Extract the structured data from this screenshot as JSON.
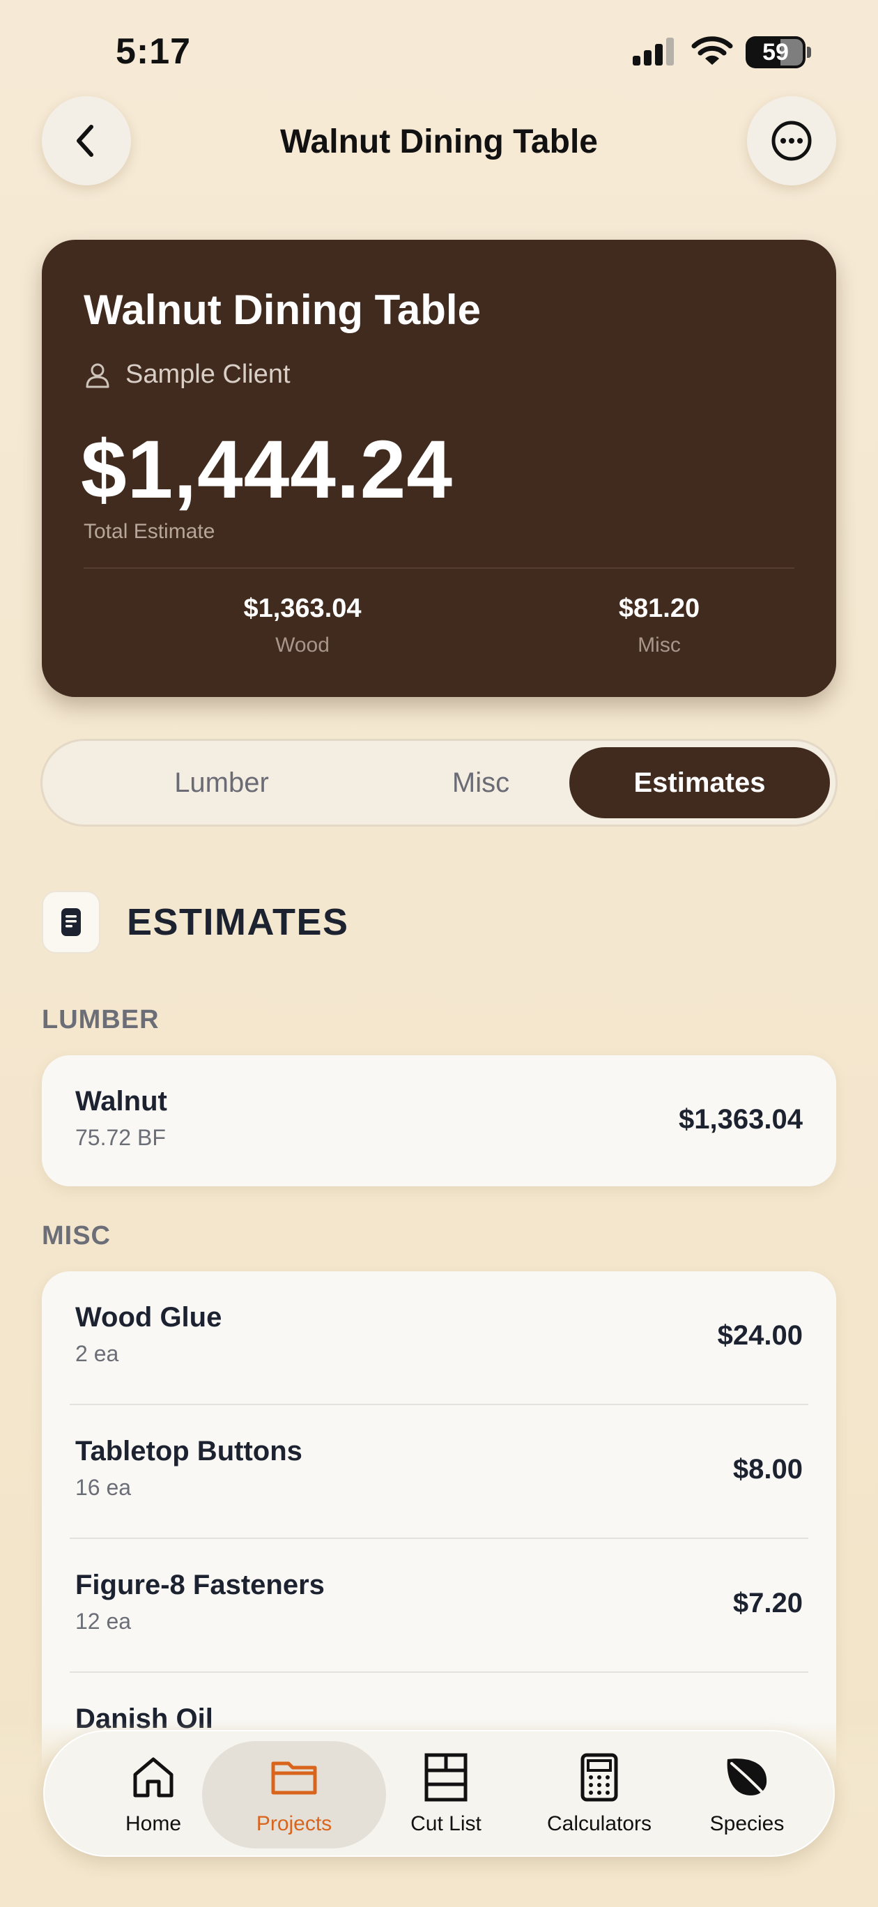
{
  "status_bar": {
    "time": "5:17",
    "battery": "59"
  },
  "nav": {
    "title": "Walnut Dining Table",
    "back_icon": "chevron-left-icon",
    "more_icon": "ellipsis-circle-icon"
  },
  "summary": {
    "title": "Walnut Dining Table",
    "client": "Sample Client",
    "total": "$1,444.24",
    "total_label": "Total Estimate",
    "wood_value": "$1,363.04",
    "wood_label": "Wood",
    "misc_value": "$81.20",
    "misc_label": "Misc"
  },
  "segments": {
    "items": [
      "Lumber",
      "Misc",
      "Estimates"
    ],
    "selected": "Estimates"
  },
  "estimates": {
    "title": "ESTIMATES",
    "lumber_label": "LUMBER",
    "lumber_items": [
      {
        "name": "Walnut",
        "qty": "75.72 BF",
        "price": "$1,363.04"
      }
    ],
    "misc_label": "MISC",
    "misc_items": [
      {
        "name": "Wood Glue",
        "qty": "2 ea",
        "price": "$24.00"
      },
      {
        "name": "Tabletop Buttons",
        "qty": "16 ea",
        "price": "$8.00"
      },
      {
        "name": "Figure-8 Fasteners",
        "qty": "12 ea",
        "price": "$7.20"
      },
      {
        "name": "Danish Oil",
        "qty": "",
        "price": ""
      }
    ]
  },
  "tab_bar": {
    "items": [
      {
        "label": "Home",
        "icon": "house-icon"
      },
      {
        "label": "Projects",
        "icon": "folder-icon"
      },
      {
        "label": "Cut List",
        "icon": "cut-list-icon"
      },
      {
        "label": "Calculators",
        "icon": "calculator-icon"
      },
      {
        "label": "Species",
        "icon": "leaf-icon"
      }
    ],
    "selected": "Projects"
  },
  "colors": {
    "card_brown": "#412b1f",
    "accent_orange": "#d9651c",
    "background": "#f4e8d0"
  }
}
